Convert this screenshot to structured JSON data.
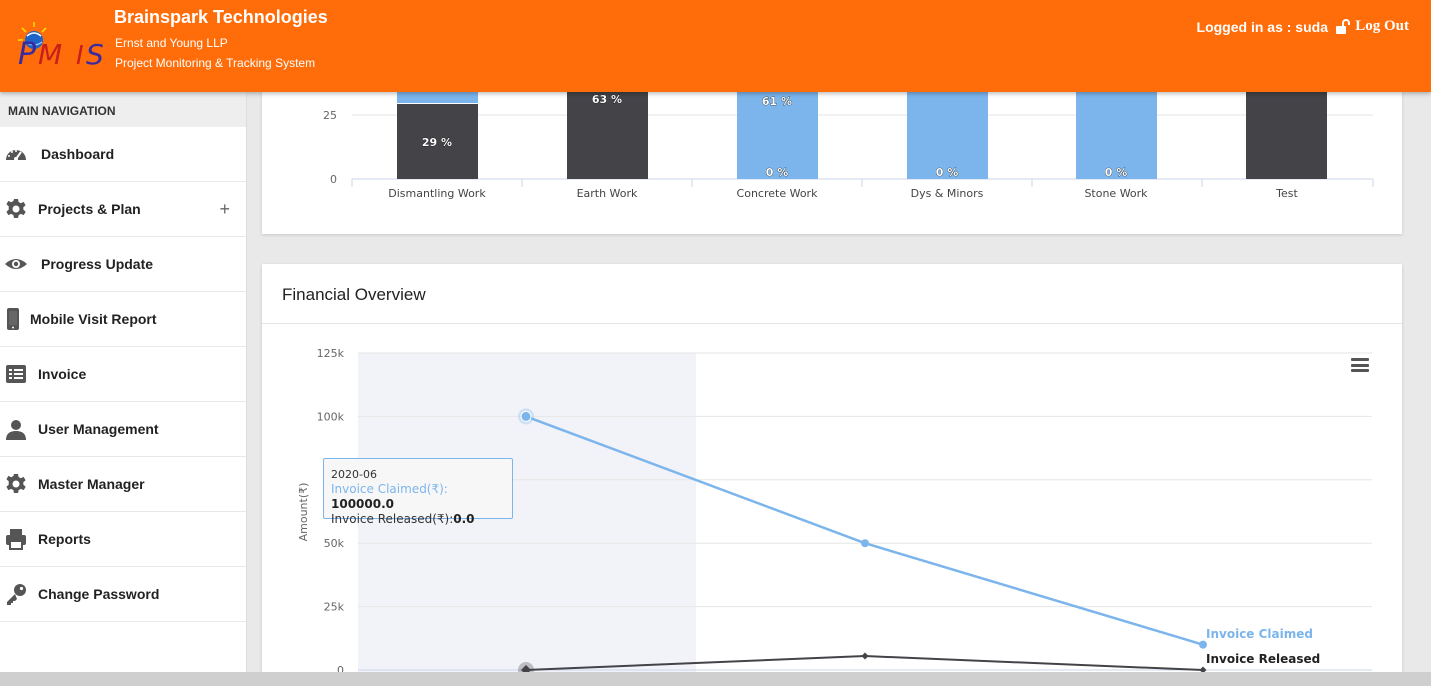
{
  "header": {
    "title": "Brainspark Technologies",
    "subtitle1": "Ernst and Young LLP",
    "subtitle2": "Project Monitoring & Tracking System",
    "logo_text": "PMIS",
    "logged_in": "Logged in as : suda",
    "logout": "Log Out",
    "bg_color": "#ff6d0a"
  },
  "sidebar": {
    "heading": "MAIN NAVIGATION",
    "items": [
      {
        "label": "Dashboard",
        "icon": "dashboard-icon"
      },
      {
        "label": "Projects & Plan",
        "icon": "gear-icon",
        "expand": "+"
      },
      {
        "label": "Progress Update",
        "icon": "eye-icon"
      },
      {
        "label": "Mobile Visit Report",
        "icon": "mobile-icon"
      },
      {
        "label": "Invoice",
        "icon": "list-icon"
      },
      {
        "label": "User Management",
        "icon": "user-icon"
      },
      {
        "label": "Master Manager",
        "icon": "gear-icon"
      },
      {
        "label": "Reports",
        "icon": "printer-icon"
      },
      {
        "label": "Change Password",
        "icon": "key-icon"
      }
    ]
  },
  "progress_chart": {
    "chart_data": {
      "type": "bar",
      "categories": [
        "Dismantling Work",
        "Earth Work",
        "Concrete Work",
        "Dys & Minors",
        "Stone Work",
        "Test"
      ],
      "y_ticks": [
        "25",
        "0"
      ],
      "series": [
        {
          "color": "#434348",
          "labels": [
            "29 %",
            "63 %",
            "",
            "",
            "",
            ""
          ]
        },
        {
          "color": "#7cb5ec",
          "labels": [
            "",
            "",
            "61 %",
            "",
            "",
            ""
          ]
        },
        {
          "color": "#7cb5ec",
          "labels": [
            "",
            "",
            "0 %",
            "0 %",
            "0 %",
            ""
          ]
        }
      ]
    }
  },
  "financial": {
    "title": "Financial Overview",
    "chart_data": {
      "type": "line",
      "x": [
        "2020-06",
        "",
        ""
      ],
      "ylabel": "Amount(₹)",
      "y_ticks": [
        "125k",
        "100k",
        "50k",
        "25k",
        "0"
      ],
      "ylim": [
        0,
        125000
      ],
      "series": [
        {
          "name": "Invoice Claimed",
          "color": "#7cb5ec",
          "values": [
            100000,
            50000,
            10000
          ]
        },
        {
          "name": "Invoice Released",
          "color": "#434348",
          "values": [
            0,
            5500,
            0
          ]
        }
      ]
    },
    "tooltip": {
      "date": "2020-06",
      "claimed_label": "Invoice Claimed(₹):",
      "claimed_value": "100000.0",
      "released_label": "Invoice Released(₹):",
      "released_value": "0.0"
    }
  }
}
